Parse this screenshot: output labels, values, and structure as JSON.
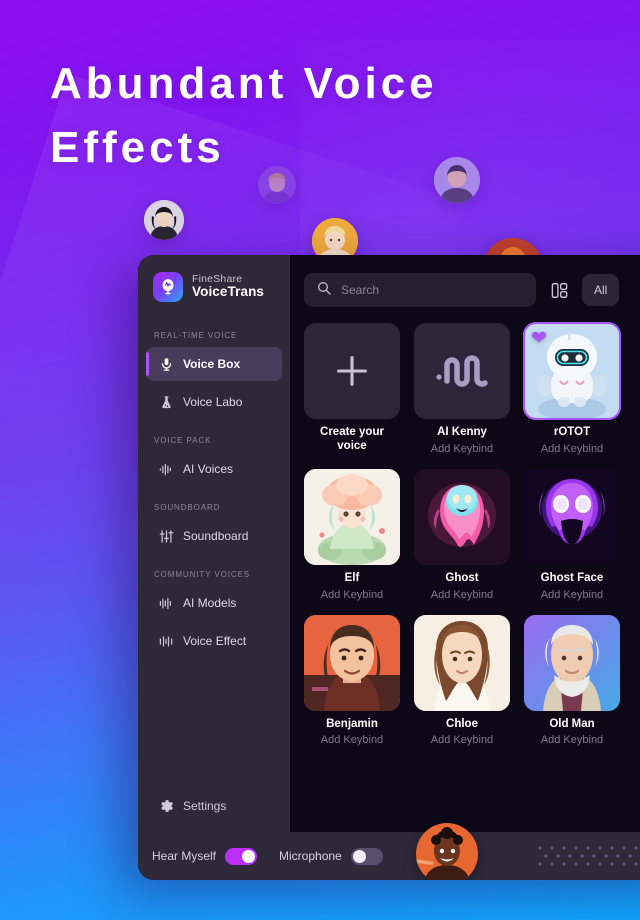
{
  "hero": {
    "title": "Abundant Voice Effects"
  },
  "theme": {
    "bg_top": "#8f0ef2",
    "bg_bottom": "#0fa6fd",
    "accent_purple": "#a855f7",
    "toggle_on": "#bb2ef8",
    "sidebar_bg": "#2d2939",
    "content_bg": "#0d0817"
  },
  "floating_avatars": [
    {
      "name": "avatar-dark-haired-girl"
    },
    {
      "name": "avatar-blonde-woman-faded"
    },
    {
      "name": "avatar-young-man-faded"
    },
    {
      "name": "avatar-blonde-woman-orange"
    },
    {
      "name": "avatar-redhead-woman"
    }
  ],
  "app": {
    "brand": {
      "sub": "FineShare",
      "main": "VoiceTrans",
      "logo_icon": "microphone-waveform-icon"
    },
    "sidebar": {
      "groups": [
        {
          "label": "REAL-TIME VOICE",
          "items": [
            {
              "label": "Voice Box",
              "icon": "microphone-icon",
              "active": true
            },
            {
              "label": "Voice Labo",
              "icon": "flask-icon",
              "active": false
            }
          ]
        },
        {
          "label": "VOICE PACK",
          "items": [
            {
              "label": "AI Voices",
              "icon": "waveform-icon",
              "active": false
            }
          ]
        },
        {
          "label": "SOUNDBOARD",
          "items": [
            {
              "label": "Soundboard",
              "icon": "sliders-icon",
              "active": false
            }
          ]
        },
        {
          "label": "COMMUNITY VOICES",
          "items": [
            {
              "label": "AI Models",
              "icon": "audio-bars-icon",
              "active": false
            },
            {
              "label": "Voice Effect",
              "icon": "equalizer-icon",
              "active": false
            }
          ]
        }
      ],
      "settings": {
        "label": "Settings",
        "icon": "gear-icon"
      }
    },
    "toolbar": {
      "search": {
        "placeholder": "Search",
        "value": "",
        "icon": "search-icon"
      },
      "layout_icon": "layout-grid-icon",
      "filter_label": "All"
    },
    "voice_cards": [
      {
        "title": "Create your voice",
        "subtitle": "",
        "icon": "plus-icon",
        "selected": false,
        "favorite": false,
        "thumb": "placeholder"
      },
      {
        "title": "AI Kenny",
        "subtitle": "Add Keybind",
        "icon": "waveform-icon",
        "selected": false,
        "favorite": false,
        "thumb": "waveform"
      },
      {
        "title": "rOTOT",
        "subtitle": "Add Keybind",
        "icon": "",
        "selected": true,
        "favorite": true,
        "thumb": "robot"
      },
      {
        "title": "Elf",
        "subtitle": "Add Keybind",
        "icon": "",
        "selected": false,
        "favorite": false,
        "thumb": "elf"
      },
      {
        "title": "Ghost",
        "subtitle": "Add Keybind",
        "icon": "",
        "selected": false,
        "favorite": false,
        "thumb": "ghost"
      },
      {
        "title": "Ghost Face",
        "subtitle": "Add Keybind",
        "icon": "",
        "selected": false,
        "favorite": false,
        "thumb": "ghostface"
      },
      {
        "title": "Benjamin",
        "subtitle": "Add Keybind",
        "icon": "",
        "selected": false,
        "favorite": false,
        "thumb": "benjamin"
      },
      {
        "title": "Chloe",
        "subtitle": "Add Keybind",
        "icon": "",
        "selected": false,
        "favorite": false,
        "thumb": "chloe"
      },
      {
        "title": "Old Man",
        "subtitle": "Add Keybind",
        "icon": "",
        "selected": false,
        "favorite": false,
        "thumb": "oldman"
      }
    ],
    "bottom_bar": {
      "hear_myself": {
        "label": "Hear Myself",
        "on": true
      },
      "microphone": {
        "label": "Microphone",
        "on": false
      },
      "avatar_icon": "user-avatar",
      "dot_grid_icon": "dot-grid-icon",
      "mic_button_icon": "microphone-icon"
    }
  }
}
